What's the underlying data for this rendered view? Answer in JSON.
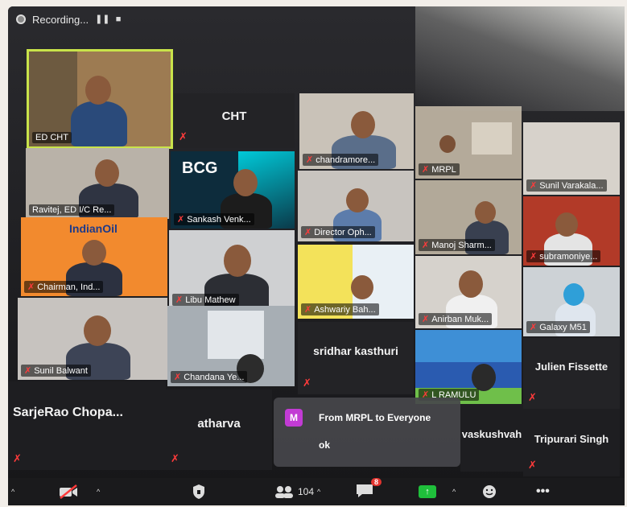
{
  "recording": {
    "label": "Recording...",
    "pause_icon": "pause-icon",
    "stop_icon": "stop-icon"
  },
  "tiles": {
    "ed_cht": "ED CHT",
    "cht": "CHT",
    "chandramore": "chandramore...",
    "mrpl": "MRPL",
    "sunil_varakala": "Sunil Varakala...",
    "ravitej": "Ravitej, ED I/C Re...",
    "bcg_logo": "BCG",
    "sankash": "Sankash Venk...",
    "director": "Director Oph...",
    "manoj": "Manoj Sharm...",
    "subramoniye": "subramoniye...",
    "indianoil_logo": "IndianOil",
    "chairman": "Chairman, Ind...",
    "libu": "Libu Mathew",
    "ashwariya": "Ashwariy Bah...",
    "anirban": "Anirban Muk...",
    "galaxy": "Galaxy M51",
    "sunil_balwant": "Sunil Balwant",
    "chandana": "Chandana Ye...",
    "sridhar": "sridhar kasthuri",
    "ramulu": "L RAMULU",
    "julien": "Julien Fissette",
    "sarjerao": "SarjeRao Chopa...",
    "atharva": "atharva",
    "vaskushvah": "vaskushvah",
    "tripurari": "Tripurari Singh"
  },
  "chat": {
    "avatar_letter": "M",
    "from": "From MRPL to Everyone",
    "message": "ok"
  },
  "toolbar": {
    "participants_count": "104",
    "chat_badge": "8"
  },
  "colors": {
    "active_speaker": "#c9e34a",
    "mute": "#ff3b3b",
    "chat_avatar": "#c23bd4",
    "share": "#1fbf3b"
  }
}
